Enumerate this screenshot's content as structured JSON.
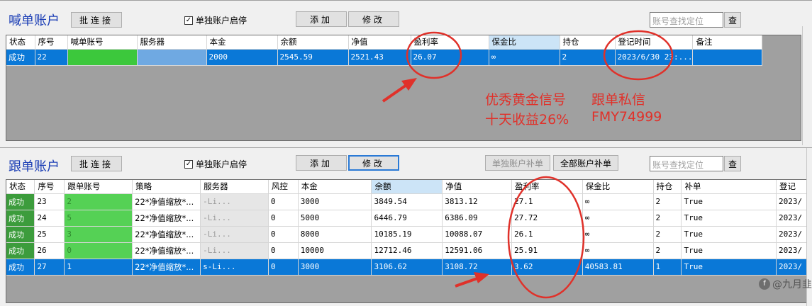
{
  "shout": {
    "title": "喊单账户",
    "batch_connect": "批连接",
    "single_toggle": "单独账户启停",
    "add": "添加",
    "edit": "修改",
    "search_placeholder": "账号查找定位",
    "search_button": "查",
    "columns": [
      "状态",
      "序号",
      "喊单账号",
      "服务器",
      "本金",
      "余额",
      "净值",
      "盈利率",
      "保金比",
      "持仓",
      "登记时间",
      "备注"
    ],
    "rows": [
      {
        "status": "成功",
        "id": "22",
        "account": "",
        "server": "",
        "principal": "2000",
        "balance": "2545.59",
        "equity": "2521.43",
        "profit_rate": "26.07",
        "margin_ratio": "∞",
        "positions": "2",
        "reg_time": "2023/6/30 23:...",
        "note": ""
      }
    ]
  },
  "annotation": {
    "line1a": "优秀黄金信号",
    "line1b": "跟单私信",
    "line2a": "十天收益26%",
    "line2b": "FMY74999"
  },
  "follow": {
    "title": "跟单账户",
    "batch_connect": "批连接",
    "single_toggle": "单独账户启停",
    "add": "添加",
    "edit": "修改",
    "single_topup": "单独账户补单",
    "all_topup": "全部账户补单",
    "search_placeholder": "账号查找定位",
    "search_button": "查",
    "columns": [
      "状态",
      "序号",
      "跟单账号",
      "策略",
      "服务器",
      "风控",
      "本金",
      "余额",
      "净值",
      "盈利率",
      "保金比",
      "持仓",
      "补单",
      "登记"
    ],
    "rows": [
      {
        "status": "成功",
        "id": "23",
        "account": "2",
        "strategy": "22*净值缩放*...",
        "server": "-Li...",
        "risk": "0",
        "principal": "3000",
        "balance": "3849.54",
        "equity": "3813.12",
        "profit_rate": "27.1",
        "margin_ratio": "∞",
        "positions": "2",
        "topup": "True",
        "reg": "2023/"
      },
      {
        "status": "成功",
        "id": "24",
        "account": "5",
        "strategy": "22*净值缩放*...",
        "server": "-Li...",
        "risk": "0",
        "principal": "5000",
        "balance": "6446.79",
        "equity": "6386.09",
        "profit_rate": "27.72",
        "margin_ratio": "∞",
        "positions": "2",
        "topup": "True",
        "reg": "2023/"
      },
      {
        "status": "成功",
        "id": "25",
        "account": "3",
        "strategy": "22*净值缩放*...",
        "server": "-Li...",
        "risk": "0",
        "principal": "8000",
        "balance": "10185.19",
        "equity": "10088.07",
        "profit_rate": "26.1",
        "margin_ratio": "∞",
        "positions": "2",
        "topup": "True",
        "reg": "2023/"
      },
      {
        "status": "成功",
        "id": "26",
        "account": "0",
        "strategy": "22*净值缩放*...",
        "server": "-Li...",
        "risk": "0",
        "principal": "10000",
        "balance": "12712.46",
        "equity": "12591.06",
        "profit_rate": "25.91",
        "margin_ratio": "∞",
        "positions": "2",
        "topup": "True",
        "reg": "2023/"
      },
      {
        "status": "成功",
        "id": "27",
        "account": "1",
        "strategy": "22*净值缩放*...",
        "server": "s-Li...",
        "risk": "0",
        "principal": "3000",
        "balance": "3106.62",
        "equity": "3108.72",
        "profit_rate": "3.62",
        "margin_ratio": "40583.81",
        "positions": "1",
        "topup": "True",
        "reg": "2023/"
      }
    ]
  },
  "watermark": {
    "text": "@九月韭"
  },
  "colors": {
    "selection": "#0a78d7",
    "success": "#3c9c3c",
    "annotation_red": "#e0312a",
    "title_blue": "#1a3db5"
  }
}
